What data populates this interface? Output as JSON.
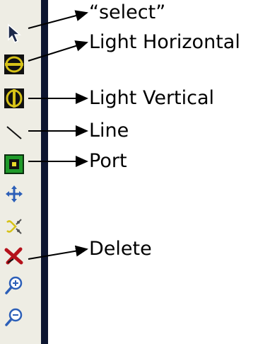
{
  "toolbar": {
    "tools": [
      {
        "icon": "select-arrow-icon"
      },
      {
        "icon": "light-horizontal-icon"
      },
      {
        "icon": "light-vertical-icon"
      },
      {
        "icon": "line-icon"
      },
      {
        "icon": "port-icon"
      },
      {
        "icon": "move-icon"
      },
      {
        "icon": "scissors-icon"
      },
      {
        "icon": "delete-icon"
      },
      {
        "icon": "zoom-in-icon"
      },
      {
        "icon": "zoom-out-icon"
      }
    ]
  },
  "callouts": {
    "select": "“select”",
    "light_horizontal": "Light Horizontal",
    "light_vertical": "Light Vertical",
    "line": "Line",
    "port": "Port",
    "delete": "Delete"
  },
  "colors": {
    "toolbar_bg": "#eeede4",
    "toolbar_edge": "#0d1530",
    "icon_yellow": "#d6c218",
    "icon_green": "#1f9a2a",
    "icon_blue": "#2c5fb8",
    "icon_red": "#b5121b"
  }
}
